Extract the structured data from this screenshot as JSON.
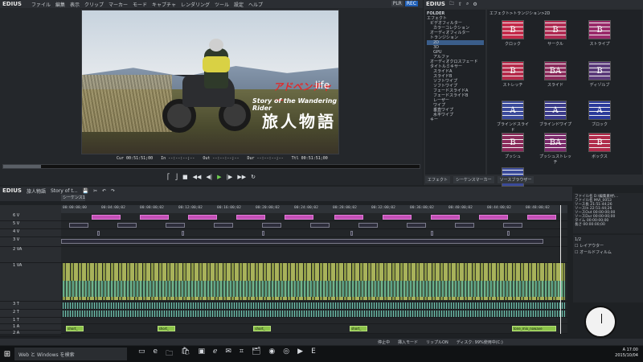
{
  "app": {
    "name": "EDIUS",
    "menu": [
      "ファイル",
      "編集",
      "表示",
      "クリップ",
      "マーカー",
      "モード",
      "キャプチャ",
      "レンダリング",
      "ツール",
      "設定",
      "ヘルプ"
    ],
    "plr": "PLR",
    "rec": "REC"
  },
  "video": {
    "title_red": "アドベンチャー",
    "title_life": "life",
    "subtitle": "Story of the Wandering Rider",
    "kanji": "旅人物語"
  },
  "timecode": {
    "cur": "Cur 00:51:51;00",
    "in": "In --:--:--;--",
    "out": "Out --:--:--;--",
    "dur": "Dur --:--:--;--",
    "ttl": "Ttl 00:51:51;00"
  },
  "scrub": {
    "progress": 0.09
  },
  "transport": {
    "icons": [
      "in-point-icon",
      "out-point-icon",
      "stop-icon",
      "rewind-icon",
      "step-back-icon",
      "play-icon",
      "step-forward-icon",
      "fast-forward-icon",
      "loop-icon"
    ]
  },
  "effects": {
    "title": "EDIUS",
    "folder_label": "FOLDER",
    "tree": [
      "エフェクト",
      "ビデオフィルター",
      "カラーコレクション",
      "オーディオフィルター",
      "トランジション",
      "2D",
      "3D",
      "GPU",
      "アルファ",
      "オーディオクロスフェード",
      "タイトルミキサー",
      "スライドA",
      "スライドB",
      "ソフトワイプ",
      "ソフトワイプ",
      "フェードスライドA",
      "フェードスライドB",
      "レーザー",
      "ワイプ",
      "垂直ワイプ",
      "水平ワイプ",
      "キー"
    ],
    "path": "エフェクト>トランジション>2D",
    "tiles": [
      {
        "label": "クロック",
        "glyph": "B",
        "color": "#c42a4a"
      },
      {
        "label": "サークル",
        "glyph": "B",
        "color": "#b02a52"
      },
      {
        "label": "ストライプ",
        "glyph": "B",
        "color": "#9a2a6a"
      },
      {
        "label": "ストレッチ",
        "glyph": "B",
        "color": "#b52a4a"
      },
      {
        "label": "スライド",
        "glyph": "BA",
        "color": "#8a2a5a"
      },
      {
        "label": "ディゾルブ",
        "glyph": "B",
        "color": "#5a3a7a"
      },
      {
        "label": "ブラインドスライド",
        "glyph": "A",
        "color": "#3a4a9a"
      },
      {
        "label": "ブラインドワイプ",
        "glyph": "A",
        "color": "#3a3a8a"
      },
      {
        "label": "ブロック",
        "glyph": "A",
        "color": "#2a3a9a"
      },
      {
        "label": "プッシュ",
        "glyph": "B",
        "color": "#8a2a5a"
      },
      {
        "label": "プッシュストレッチ",
        "glyph": "BA",
        "color": "#7a2a6a"
      },
      {
        "label": "ボックス",
        "glyph": "B",
        "color": "#b02a4a"
      },
      {
        "label": "",
        "glyph": "",
        "color": "#3a4a9a"
      }
    ],
    "tabs": [
      "エフェクト",
      "シーケンスマーカー",
      "ソースブラウザー"
    ]
  },
  "timeline": {
    "title": "EDIUS",
    "project": "旅人物語",
    "project_sub": "Story of t...",
    "sequence_tab": "シーケンス1",
    "ruler": [
      "00:00:00;00",
      "00:04:00;02",
      "00:08:00;02",
      "00:12:00;02",
      "00:16:00;02",
      "00:20:00;02",
      "00:24:00;02",
      "00:28:00;02",
      "00:32:00;02",
      "00:36:00;02",
      "00:40:00;02",
      "00:44:00;02",
      "00:48:00;02"
    ],
    "tracks": [
      {
        "name": "6 V"
      },
      {
        "name": "5 V"
      },
      {
        "name": "4 V"
      },
      {
        "name": "3 V"
      },
      {
        "name": "2 VA"
      },
      {
        "name": "1 VA"
      },
      {
        "name": "3 T"
      },
      {
        "name": "2 T"
      },
      {
        "name": "1 T"
      },
      {
        "name": "1 A"
      },
      {
        "name": "2 A"
      }
    ],
    "audio_clips": [
      {
        "label": "short_",
        "start": 0.01
      },
      {
        "label": "short_",
        "start": 0.19
      },
      {
        "label": "short_",
        "start": 0.38
      },
      {
        "label": "short_",
        "start": 0.57
      },
      {
        "label": "tone_mix_nowave",
        "start": 0.89
      }
    ]
  },
  "info": {
    "lines": [
      "ファイル名 D:\\編集素材\\...",
      "ファイル名 MVI_0053",
      "ソース長 21:51:44;26",
      "ソースIn 22:51:44;26",
      "ソースOut 00:00:00;00",
      "ソースDur 00:00:00;00",
      "タイム 00:00:00;00",
      "長さ 00:00:00;00"
    ]
  },
  "layer": {
    "page": "1/2",
    "items": [
      "レイアウター",
      "オールドフィルム"
    ]
  },
  "status": [
    "停止中",
    "挿入モード",
    "リップルON",
    "ディスク: 99%使用中(C:)"
  ],
  "taskbar": {
    "search": "Web と Windows を検索",
    "time": "17:00",
    "date": "2015/10/04",
    "ime": "A"
  }
}
